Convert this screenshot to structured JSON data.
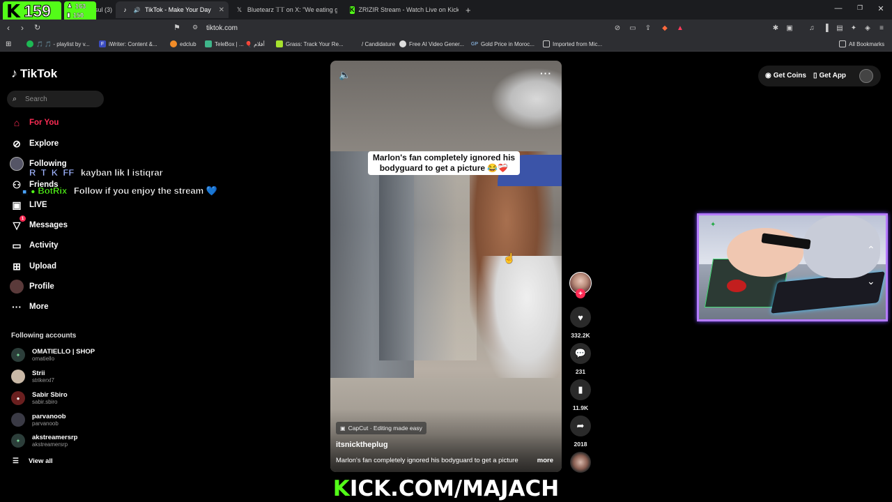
{
  "colors": {
    "accent": "#fe2c55",
    "kick_green": "#53fc18",
    "cam_border": "#b57cff"
  },
  "stream_overlay": {
    "kick_logo": "K",
    "viewer_count": "159",
    "stat_followers": "163",
    "stat_subs": "150",
    "banner_prefix": "K",
    "banner_rest": "ICK.COM/MAJACH"
  },
  "tabs": [
    {
      "label": "sul (3)",
      "icon": "whatsapp-icon",
      "active": false
    },
    {
      "label": "TikTok - Make Your Day",
      "icon": "tiktok-icon",
      "active": true
    },
    {
      "label": "Bluetearz 𝕋𝕋 on X: \"We eating good 🍁",
      "icon": "x-icon",
      "active": false
    },
    {
      "label": "ZRIZIR Stream - Watch Live on Kick",
      "icon": "kick-icon",
      "active": false
    }
  ],
  "address": {
    "url": "tiktok.com"
  },
  "bookmarks": [
    {
      "label": "🎵 🎵 - playlist by v...",
      "icon": "spotify-icon"
    },
    {
      "label": "iWriter: Content &...",
      "icon": "iwriter-icon"
    },
    {
      "label": "edclub",
      "icon": "edclub-icon"
    },
    {
      "label": "TeleBox | ... 🎈 أفلام",
      "icon": "telebox-icon"
    },
    {
      "label": "Grass: Track Your Re...",
      "icon": "grass-icon"
    },
    {
      "label": "/ Candidature",
      "icon": "candidature-icon"
    },
    {
      "label": "Free AI Video Gener...",
      "icon": "ai-video-icon"
    },
    {
      "label": "Gold Price in Moroc...",
      "icon": "gold-icon"
    },
    {
      "label": "Imported from Mic...",
      "icon": "folder-icon"
    },
    {
      "label": "All Bookmarks",
      "icon": "folder-icon"
    }
  ],
  "tiktok": {
    "brand": "TikTok",
    "search_placeholder": "Search",
    "nav": [
      {
        "label": "For You",
        "icon": "home-icon"
      },
      {
        "label": "Explore",
        "icon": "compass-icon"
      },
      {
        "label": "Following",
        "icon": "following-avatar-icon"
      },
      {
        "label": "Friends",
        "icon": "friends-icon"
      },
      {
        "label": "LIVE",
        "icon": "live-icon"
      },
      {
        "label": "Messages",
        "icon": "messages-icon",
        "badge": "1"
      },
      {
        "label": "Activity",
        "icon": "activity-icon"
      },
      {
        "label": "Upload",
        "icon": "upload-icon"
      },
      {
        "label": "Profile",
        "icon": "profile-icon"
      },
      {
        "label": "More",
        "icon": "more-icon"
      }
    ],
    "following_title": "Following accounts",
    "accounts": [
      {
        "name": "OMATIELLO | SHOP",
        "handle": "omatiello"
      },
      {
        "name": "Strii",
        "handle": "strikerxl7"
      },
      {
        "name": "Sabir Sbiro",
        "handle": "sabir.sbiro"
      },
      {
        "name": "parvanoob",
        "handle": "parvanoob"
      },
      {
        "name": "akstreamersrp",
        "handle": "akstreamersrp"
      }
    ],
    "view_all": "View all",
    "top_right": {
      "get_coins": "Get Coins",
      "get_app": "Get App"
    }
  },
  "chat": [
    {
      "user": "R_T_K_FF",
      "message": "kayban lik l istiqrar"
    },
    {
      "user": "BotRix",
      "message": "Follow if you enjoy the stream 💙"
    }
  ],
  "video": {
    "caption_overlay": "Marlon's fan completely ignored his bodyguard to get a picture 😂❤️‍🩹",
    "capcut_tag": "CapCut · Editing made easy",
    "username": "itsnicktheplug",
    "description": "Marlon's fan completely ignored his bodyguard to get a picture",
    "more": "more",
    "likes": "332.2K",
    "comments": "231",
    "saves": "11.9K",
    "shares": "2018"
  }
}
